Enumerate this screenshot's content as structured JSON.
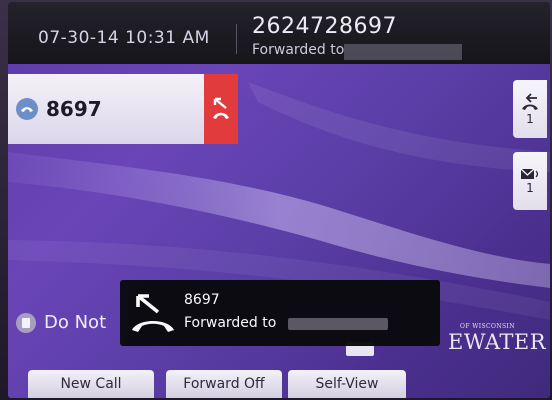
{
  "header": {
    "datetime": "07-30-14 10:31 AM",
    "caller_number": "2624728697",
    "forwarded_label": "Forwarded to"
  },
  "line": {
    "number": "8697",
    "forward_indicator_icon": "call-forward-icon",
    "indicator_color": "#e23b3e"
  },
  "side_keys": {
    "recent_calls_count": "1",
    "voicemail_count": "1"
  },
  "dnd": {
    "label": "Do Not"
  },
  "popup": {
    "number": "8697",
    "forwarded_label": "Forwarded to"
  },
  "logo": {
    "small": "OF WISCONSIN",
    "big": "EWATER"
  },
  "softkeys": {
    "new_call": "New Call",
    "forward_off": "Forward Off",
    "self_view": "Self-View"
  }
}
